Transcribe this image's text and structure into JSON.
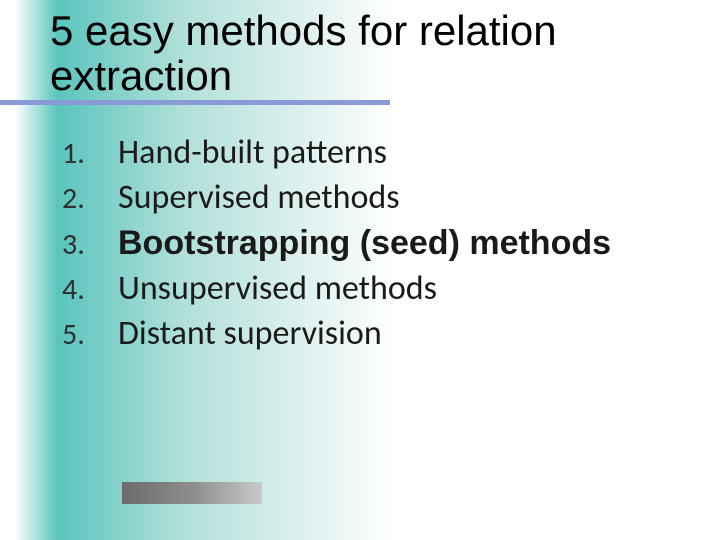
{
  "title": "5 easy methods for relation extraction",
  "items": [
    {
      "n": "1.",
      "t": "Hand-built patterns"
    },
    {
      "n": "2.",
      "t": "Supervised methods"
    },
    {
      "n": "3.",
      "t": "Bootstrapping (seed) methods"
    },
    {
      "n": "4.",
      "t": "Unsupervised methods"
    },
    {
      "n": "5.",
      "t": "Distant supervision"
    }
  ]
}
